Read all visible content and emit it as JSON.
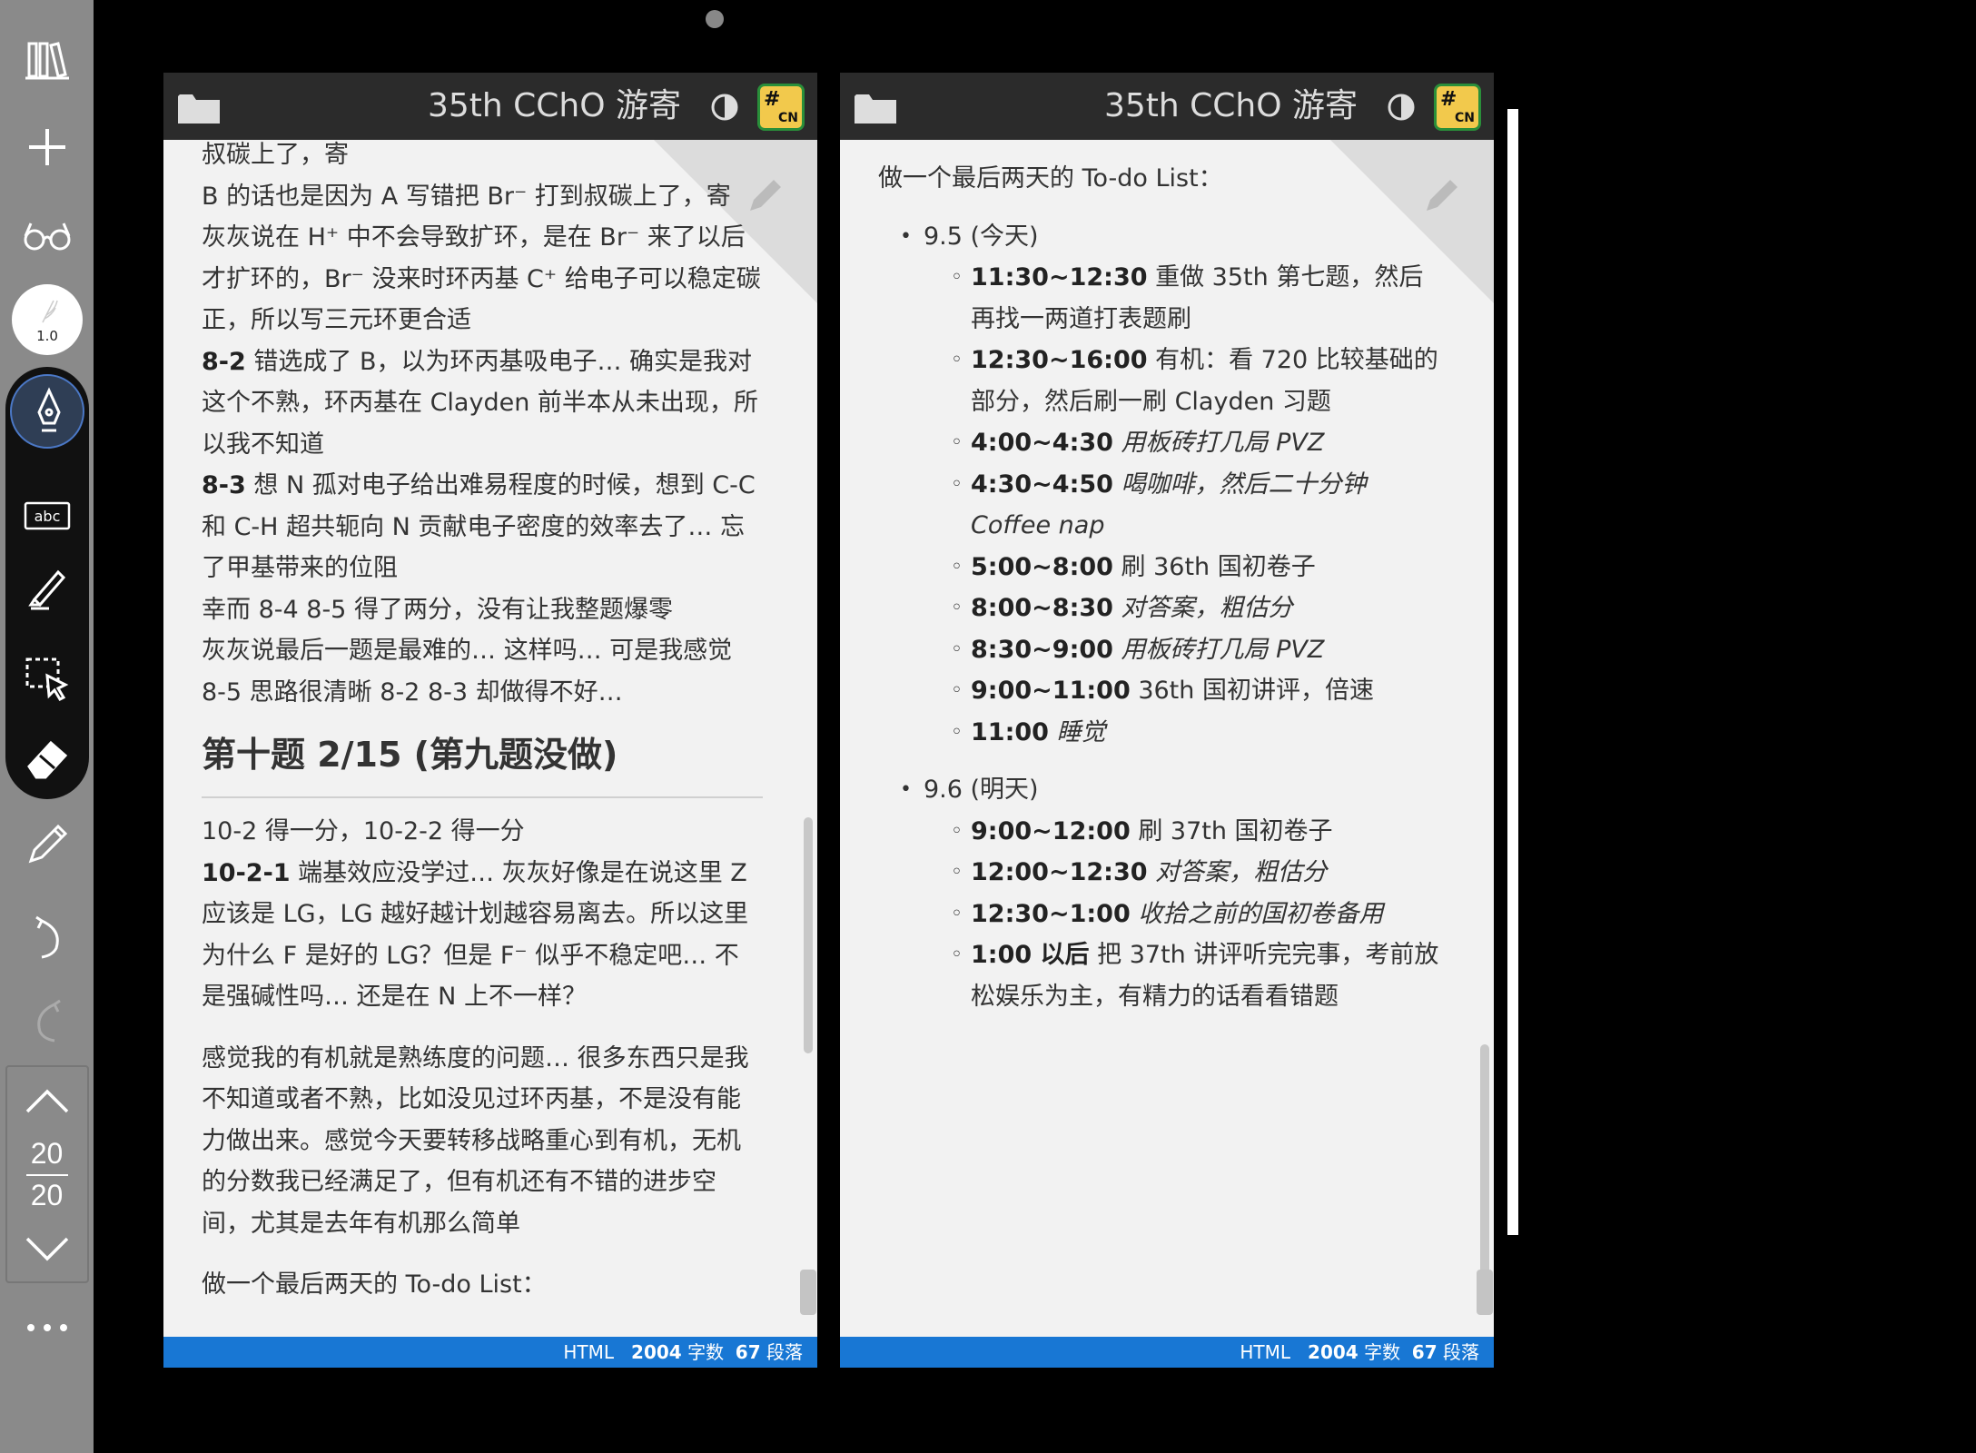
{
  "sidebar": {
    "pen_size": "1.0",
    "page_current": "20",
    "page_total": "20"
  },
  "left_pane": {
    "title": "35th CChO 游寄",
    "status": {
      "format": "HTML",
      "count1": "2004",
      "unit1": "字数",
      "count2": "67",
      "unit2": "段落"
    },
    "paragraphs": [
      {
        "text": "叔碳上了，寄"
      },
      {
        "text": "B 的话也是因为 A 写错把 Br⁻ 打到叔碳上了，寄"
      },
      {
        "text": "灰灰说在 H⁺ 中不会导致扩环，是在 Br⁻ 来了以后才扩环的，Br⁻ 没来时环丙基 C⁺ 给电子可以稳定碳正，所以写三元环更合适"
      },
      {
        "bold": "8-2",
        "text": " 错选成了 B，以为环丙基吸电子… 确实是我对这个不熟，环丙基在 Clayden 前半本从未出现，所以我不知道"
      },
      {
        "bold": "8-3",
        "text": " 想 N 孤对电子给出难易程度的时候，想到 C-C 和 C-H 超共轭向 N 贡献电子密度的效率去了… 忘了甲基带来的位阻"
      },
      {
        "text": "幸而 8-4 8-5 得了两分，没有让我整题爆零"
      },
      {
        "text": "灰灰说最后一题是最难的… 这样吗… 可是我感觉 8-5 思路很清晰 8-2 8-3 却做得不好…"
      }
    ],
    "heading": "第十题 2/15 (第九题没做)",
    "paragraphs2": [
      {
        "text": "10-2 得一分，10-2-2 得一分"
      },
      {
        "bold": "10-2-1",
        "text": " 端基效应没学过… 灰灰好像是在说这里 Z 应该是 LG，LG 越好越计划越容易离去。所以这里为什么 F 是好的 LG？但是 F⁻ 似乎不稳定吧… 不是强碱性吗… 还是在 N 上不一样？"
      }
    ],
    "paragraph3": "感觉我的有机就是熟练度的问题… 很多东西只是我不知道或者不熟，比如没见过环丙基，不是没有能力做出来。感觉今天要转移战略重心到有机，无机的分数我已经满足了，但有机还有不错的进步空间，尤其是去年有机那么简单",
    "paragraph4": "做一个最后两天的 To-do List："
  },
  "right_pane": {
    "title": "35th CChO 游寄",
    "status": {
      "format": "HTML",
      "count1": "2004",
      "unit1": "字数",
      "count2": "67",
      "unit2": "段落"
    },
    "intro": "做一个最后两天的 To-do List：",
    "days": [
      {
        "label": "9.5 (今天)",
        "items": [
          {
            "time": "11:30~12:30",
            "text": " 重做 35th 第七题，然后再找一两道打表题刷",
            "italic": false
          },
          {
            "time": "12:30~16:00",
            "text": " 有机：看 720 比较基础的部分，然后刷一刷 Clayden 习题",
            "italic": false
          },
          {
            "time": "4:00~4:30",
            "text": " 用板砖打几局 PVZ",
            "italic": true
          },
          {
            "time": "4:30~4:50",
            "text": " 喝咖啡，然后二十分钟 Coffee nap",
            "italic": true
          },
          {
            "time": "5:00~8:00",
            "text": " 刷 36th 国初卷子",
            "italic": false
          },
          {
            "time": "8:00~8:30",
            "text": " 对答案，粗估分",
            "italic": true
          },
          {
            "time": "8:30~9:00",
            "text": " 用板砖打几局 PVZ",
            "italic": true
          },
          {
            "time": "9:00~11:00",
            "text": " 36th 国初讲评，倍速",
            "italic": false
          },
          {
            "time": "11:00",
            "text": " 睡觉",
            "italic": true
          }
        ]
      },
      {
        "label": "9.6 (明天)",
        "items": [
          {
            "time": "9:00~12:00",
            "text": " 刷 37th 国初卷子",
            "italic": false
          },
          {
            "time": "12:00~12:30",
            "text": " 对答案，粗估分",
            "italic": true
          },
          {
            "time": "12:30~1:00",
            "text": " 收拾之前的国初卷备用",
            "italic": true
          },
          {
            "time": "1:00 以后",
            "text": " 把 37th 讲评听完完事，考前放松娱乐为主，有精力的话看看错题",
            "italic": false
          }
        ]
      }
    ]
  },
  "colors": {
    "header_bg": "#2b2b2b",
    "status_bar": "#1877d4",
    "sidebar_bg": "#8a8a8a",
    "active_tool_ring": "#4b78c6"
  },
  "icons": [
    "library-icon",
    "plus-icon",
    "glasses-icon",
    "feather-icon",
    "fountain-pen-icon",
    "text-box-icon",
    "highlighter-icon",
    "lasso-select-icon",
    "eraser-icon",
    "pencil-icon",
    "undo-icon",
    "redo-icon",
    "chevron-up-icon",
    "chevron-down-icon",
    "more-icon",
    "folder-icon",
    "contrast-icon",
    "app-icon"
  ]
}
